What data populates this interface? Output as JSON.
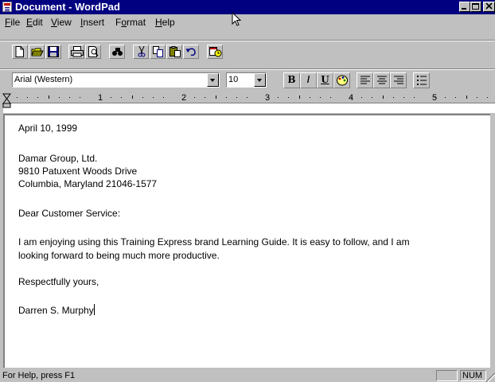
{
  "window": {
    "title": "Document - WordPad"
  },
  "menu": {
    "file": {
      "u": "F",
      "rest": "ile"
    },
    "edit": {
      "u": "E",
      "rest": "dit"
    },
    "view": {
      "u": "V",
      "rest": "iew"
    },
    "insert": {
      "u": "I",
      "rest": "nsert"
    },
    "format": {
      "pre": "F",
      "u": "o",
      "rest": "rmat"
    },
    "help": {
      "u": "H",
      "rest": "elp"
    }
  },
  "toolbar": {
    "icons": [
      "new-icon",
      "open-icon",
      "save-icon",
      "print-icon",
      "print-preview-icon",
      "find-icon",
      "cut-icon",
      "copy-icon",
      "paste-icon",
      "undo-icon",
      "date-time-icon"
    ]
  },
  "format_bar": {
    "font": "Arial (Western)",
    "size": "10",
    "bold": "B",
    "italic": "/",
    "underline": "U"
  },
  "ruler": {
    "numbers": [
      "1",
      "2",
      "3",
      "4",
      "5"
    ]
  },
  "document": {
    "date": "April 10, 1999",
    "addr1": "Damar Group, Ltd.",
    "addr2": "9810 Patuxent Woods Drive",
    "addr3": "Columbia, Maryland  21046-1577",
    "salutation": "Dear Customer Service:",
    "body1": "I am enjoying using this Training Express brand Learning Guide.  It is easy to follow, and I am",
    "body2": "looking forward to being much more productive.",
    "closing": "Respectfully yours,",
    "signature": "Darren S. Murphy"
  },
  "status": {
    "help": "For Help, press F1",
    "num": "NUM"
  }
}
